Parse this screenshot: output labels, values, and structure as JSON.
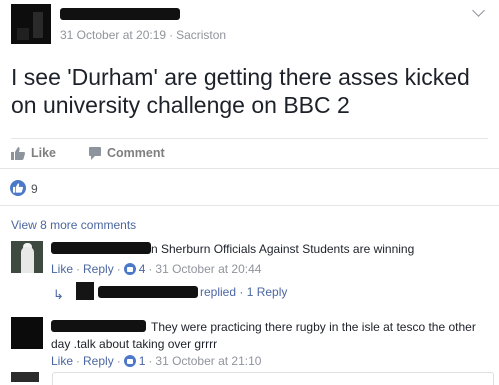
{
  "post": {
    "timestamp": "31 October at 20:19",
    "location": "Sacriston",
    "separator": "·",
    "text": "I see 'Durham' are getting there asses kicked on university challenge on BBC 2"
  },
  "actions": {
    "like_label": "Like",
    "comment_label": "Comment"
  },
  "reactions": {
    "count": "9"
  },
  "comments_section": {
    "view_more": "View 8 more comments",
    "comments": [
      {
        "text": "n Sherburn Officials Against Students are winning",
        "like_label": "Like",
        "reply_label": "Reply",
        "like_count": "4",
        "timestamp": "31 October at 20:44",
        "replies_summary": "replied · 1 Reply"
      },
      {
        "text": "They were practicing there rugby in the isle at tesco the other day .talk about taking over grrrr",
        "like_label": "Like",
        "reply_label": "Reply",
        "like_count": "1",
        "timestamp": "31 October at 21:10"
      }
    ]
  },
  "colors": {
    "link": "#4b67a1",
    "meta": "#90949c",
    "like_blue": "#4c78c9",
    "divider": "#e5e5e5"
  }
}
